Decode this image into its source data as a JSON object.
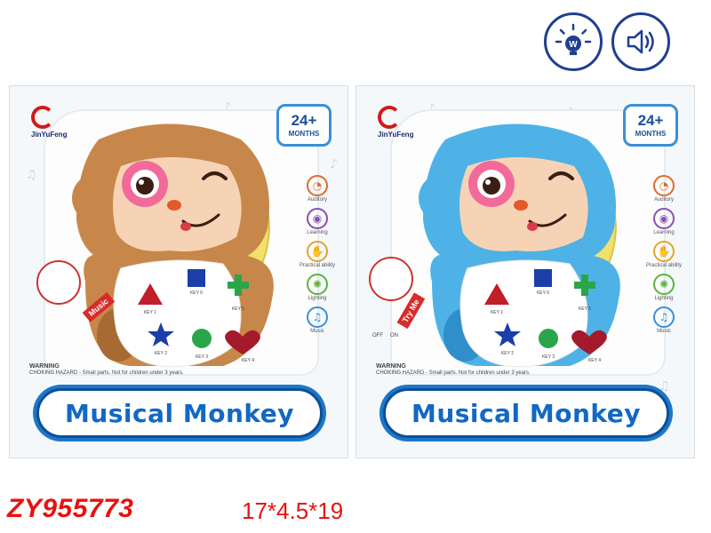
{
  "top_icons": [
    {
      "name": "light-bulb-icon"
    },
    {
      "name": "speaker-icon"
    }
  ],
  "boxes": [
    {
      "brand": "JinYuFeng",
      "age_badge": {
        "main": "24+",
        "sub": "MONTHS"
      },
      "title": "Musical Monkey",
      "monkey_color": "#c8874a",
      "monkey_dark": "#a86a33",
      "features": [
        {
          "label": "Auditory",
          "icon": "ear-icon",
          "color": "#e06a2b"
        },
        {
          "label": "Learning",
          "icon": "eye-icon",
          "color": "#8a4fb0"
        },
        {
          "label": "Practical ability",
          "icon": "hand-icon",
          "color": "#e6a32a"
        },
        {
          "label": "Lighting",
          "icon": "bulb-icon",
          "color": "#5ab43a"
        },
        {
          "label": "Music",
          "icon": "note-icon",
          "color": "#3a8fd8"
        }
      ],
      "keys": [
        {
          "label": "KEY 1",
          "shape": "triangle",
          "color": "#c11e2a"
        },
        {
          "label": "KEY 6",
          "shape": "square",
          "color": "#1b3ea8"
        },
        {
          "label": "KEY 5",
          "shape": "cross",
          "color": "#2aa54a"
        },
        {
          "label": "KEY 2",
          "shape": "star",
          "color": "#1b3ea8"
        },
        {
          "label": "KEY 3",
          "shape": "circle",
          "color": "#2aa54a"
        },
        {
          "label": "KEY 4",
          "shape": "heart",
          "color": "#a51a2a"
        }
      ],
      "tag": "Music",
      "warning_title": "WARNING",
      "warning_text": "CHOKING HAZARD - Small parts. Not for children under 3 years."
    },
    {
      "brand": "JinYuFeng",
      "age_badge": {
        "main": "24+",
        "sub": "MONTHS"
      },
      "title": "Musical Monkey",
      "monkey_color": "#4fb2e6",
      "monkey_dark": "#2f8fcb",
      "features": [
        {
          "label": "Auditory",
          "icon": "ear-icon",
          "color": "#e06a2b"
        },
        {
          "label": "Learning",
          "icon": "eye-icon",
          "color": "#8a4fb0"
        },
        {
          "label": "Practical ability",
          "icon": "hand-icon",
          "color": "#e6a32a"
        },
        {
          "label": "Lighting",
          "icon": "bulb-icon",
          "color": "#5ab43a"
        },
        {
          "label": "Music",
          "icon": "note-icon",
          "color": "#3a8fd8"
        }
      ],
      "keys": [
        {
          "label": "KEY 1",
          "shape": "triangle",
          "color": "#c11e2a"
        },
        {
          "label": "KEY 6",
          "shape": "square",
          "color": "#1b3ea8"
        },
        {
          "label": "KEY 5",
          "shape": "cross",
          "color": "#2aa54a"
        },
        {
          "label": "KEY 2",
          "shape": "star",
          "color": "#1b3ea8"
        },
        {
          "label": "KEY 3",
          "shape": "circle",
          "color": "#2aa54a"
        },
        {
          "label": "KEY 4",
          "shape": "heart",
          "color": "#a51a2a"
        }
      ],
      "tag": "Try Me",
      "switch_labels": [
        "OFF",
        "ON"
      ],
      "warning_title": "WARNING",
      "warning_text": "CHOKING HAZARD - Small parts. Not for children under 3 years."
    }
  ],
  "product_code": "ZY955773",
  "dimensions": "17*4.5*19"
}
